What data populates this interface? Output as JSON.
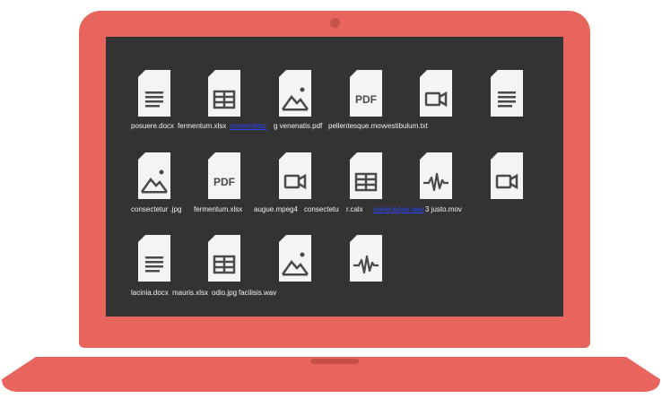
{
  "desktop": {
    "files": [
      {
        "name": "posuere.docx",
        "icon": "document-icon"
      },
      {
        "name": "fermentum.xlsx",
        "icon": "spreadsheet-icon"
      },
      {
        "name": "consectetur",
        "icon": "image-icon",
        "selected": true
      },
      {
        "name": "g venenatis.pdf",
        "icon": "pdf-icon"
      },
      {
        "name": "pellentesque.mov",
        "icon": "video-icon"
      },
      {
        "name": "vestibulum.txt",
        "icon": "document-icon"
      },
      {
        "name": "consectetur .jpg",
        "icon": "image-icon"
      },
      {
        "name": "fermentum.xlsx",
        "icon": "pdf-icon"
      },
      {
        "name": "augue.mpeg4",
        "icon": "video-icon"
      },
      {
        "name": "consectetu",
        "icon": "spreadsheet-icon"
      },
      {
        "name": "r.calx",
        "icon": "audio-icon"
      },
      {
        "name": "scelerisque.wav",
        "icon": "video-icon",
        "selected": true
      },
      {
        "name": "3 justo.mov",
        "icon": "video-icon"
      },
      {
        "name": "lacinia.docx",
        "icon": "document-icon"
      },
      {
        "name": "mauris.xlsx",
        "icon": "spreadsheet-icon"
      },
      {
        "name": "odio.jpg",
        "icon": "image-icon"
      },
      {
        "name": "facilisis.wav",
        "icon": "audio-icon"
      }
    ],
    "pdf_glyph": "PDF"
  },
  "colors": {
    "laptop_body": "#e8655e",
    "screen": "#333334",
    "file_paper": "#f4f4f4",
    "file_glyph": "#4a4a4a",
    "label_text": "#f2f2f2",
    "selection_link": "#2a44ff"
  }
}
